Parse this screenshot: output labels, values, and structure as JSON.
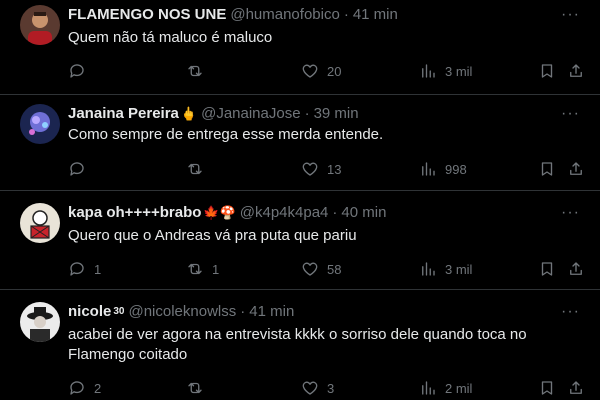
{
  "tweets": [
    {
      "name": "FLAMENGO NOS UNE",
      "handle": "@humanofobico",
      "time": "41 min",
      "text": "Quem não tá maluco é maluco",
      "replies": "",
      "retweets": "",
      "likes": "20",
      "views": "3 mil"
    },
    {
      "name": "Janaina Pereira",
      "badge": "🖕",
      "handle": "@JanainaJose",
      "time": "39 min",
      "text": "Como sempre de entrega esse merda entende.",
      "replies": "",
      "retweets": "",
      "likes": "13",
      "views": "998"
    },
    {
      "name": "kapa oh++++brabo",
      "badge": "🍁🍄",
      "handle": "@k4p4k4pa4",
      "time": "40 min",
      "text": "Quero que o Andreas vá pra puta que pariu",
      "replies": "1",
      "retweets": "1",
      "likes": "58",
      "views": "3 mil"
    },
    {
      "name": "nicole",
      "badge": "30",
      "handle": "@nicoleknowlss",
      "time": "41 min",
      "text": "acabei de ver agora na entrevista kkkk o sorriso dele quando toca no Flamengo coitado",
      "replies": "2",
      "retweets": "",
      "likes": "3",
      "views": "2 mil"
    }
  ],
  "more_label": "···",
  "dot": "·",
  "icons": [
    "reply-icon",
    "retweet-icon",
    "like-icon",
    "views-icon",
    "bookmark-icon",
    "share-icon"
  ],
  "colors": {
    "background": "#000000",
    "text": "#e7e9ea",
    "muted": "#71767b",
    "divider": "#2f3336"
  }
}
